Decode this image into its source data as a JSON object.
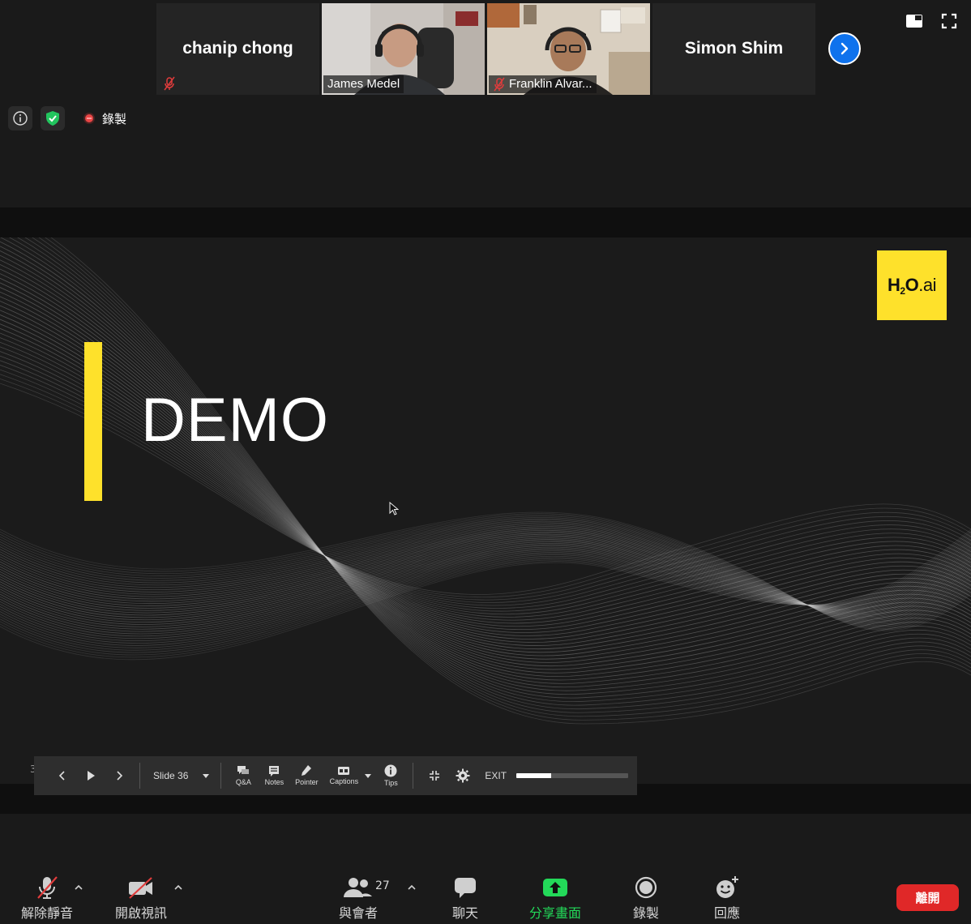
{
  "gallery": {
    "participants": [
      {
        "name": "chanip chong",
        "muted": true,
        "video": false
      },
      {
        "name": "James Medel",
        "muted": false,
        "video": true
      },
      {
        "name": "Franklin Alvar...",
        "muted": true,
        "video": true
      },
      {
        "name": "Simon Shim",
        "muted": false,
        "video": false
      }
    ]
  },
  "meeting_info": {
    "recording_label": "錄製"
  },
  "slide": {
    "title": "DEMO",
    "logo": {
      "main": "H",
      "sub": "2",
      "o": "O",
      "suffix": ".ai"
    },
    "colors": {
      "accent": "#fee12b",
      "background": "#1b1b1b"
    }
  },
  "slide_controls": {
    "slide_label": "Slide 36",
    "qa_label": "Q&A",
    "notes_label": "Notes",
    "pointer_label": "Pointer",
    "captions_label": "Captions",
    "tips_label": "Tips",
    "exit_label": "EXIT",
    "progress": 0.31,
    "peek_number": "3"
  },
  "toolbar": {
    "unmute_label": "解除靜音",
    "start_video_label": "開啟視訊",
    "participants_label": "與會者",
    "participants_count": "27",
    "chat_label": "聊天",
    "share_label": "分享畫面",
    "record_label": "錄製",
    "reactions_label": "回應",
    "leave_label": "離開",
    "colors": {
      "share": "#23d959",
      "leave": "#e02828"
    }
  }
}
